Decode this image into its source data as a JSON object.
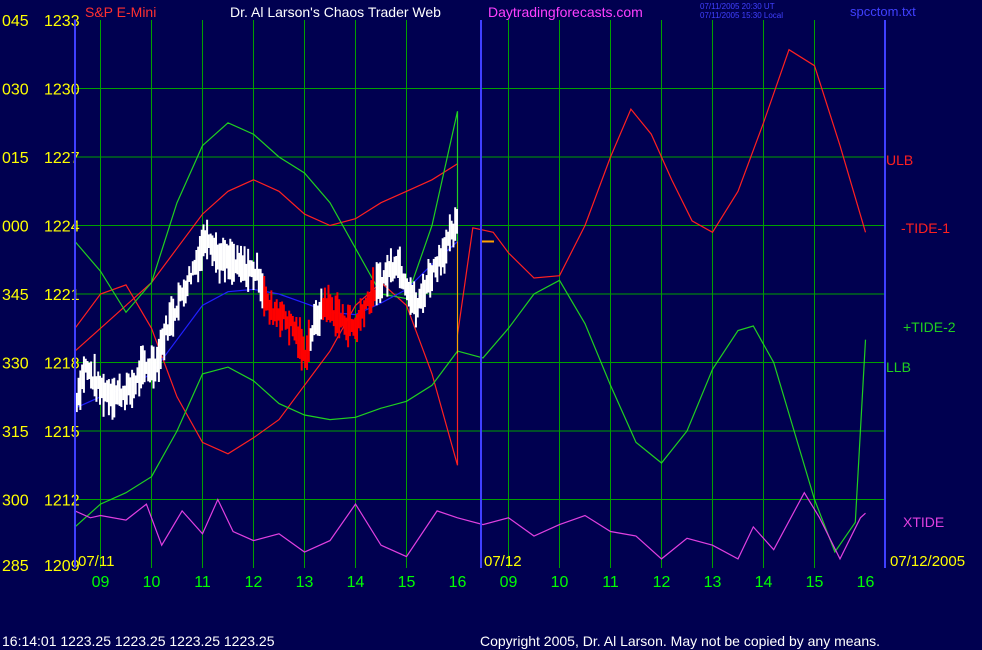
{
  "header": {
    "instrument": "S&P E-Mini",
    "title": "Dr. Al Larson's Chaos Trader Web",
    "site": "Daytradingforecasts.com",
    "stamp_line1": "07/11/2005 20:30 UT",
    "stamp_line2": "07/11/2005 15:30 Local",
    "filename": "spcctom.txt"
  },
  "footer": {
    "status": "16:14:01  1223.25 1223.25 1223.25 1223.25",
    "copyright": "Copyright 2005, Dr. Al Larson. May not be copied by any means."
  },
  "labels": {
    "day1": "07/11",
    "day2": "07/12",
    "day_end": "07/12/2005"
  },
  "colors": {
    "background": "#000050",
    "grid": "#00a000",
    "axis": "#4040ff",
    "price_axis": "#ffff00",
    "hour_labels": "#00ff00",
    "ulb": "#ff2020",
    "tide1": "#ff2020",
    "tide2": "#20d020",
    "llb": "#20d020",
    "xtide": "#e040e0",
    "price_bars": "#ffffff",
    "price_down": "#ff0000",
    "moving_avg": "#2020ff",
    "header_title": "#ffffff",
    "header_site": "#ff40ff",
    "filename": "#4040ff"
  },
  "chart_data": {
    "type": "line",
    "title": "Dr. Al Larson's Chaos Trader Web",
    "y_axis": {
      "ticks": [
        {
          "code": "045",
          "price": "1233"
        },
        {
          "code": "030",
          "price": "1230"
        },
        {
          "code": "015",
          "price": "1227"
        },
        {
          "code": "000",
          "price": "1224"
        },
        {
          "code": "345",
          "price": "1221"
        },
        {
          "code": "330",
          "price": "1218"
        },
        {
          "code": "315",
          "price": "1215"
        },
        {
          "code": "300",
          "price": "1212"
        },
        {
          "code": "285",
          "price": "1209"
        }
      ],
      "ylim": [
        1209,
        1233
      ]
    },
    "x_axis": {
      "ticks": [
        "09",
        "10",
        "11",
        "12",
        "13",
        "14",
        "15",
        "16",
        "09",
        "10",
        "11",
        "12",
        "13",
        "14",
        "15",
        "16"
      ],
      "xlim": [
        8.5,
        24.0
      ]
    },
    "grid": true,
    "series": [
      {
        "name": "ULB",
        "points": [
          [
            8.5,
            1218.5
          ],
          [
            9,
            1219.5
          ],
          [
            9.5,
            1220.5
          ],
          [
            10,
            1221.5
          ],
          [
            10.5,
            1223
          ],
          [
            11,
            1224.5
          ],
          [
            11.5,
            1225.5
          ],
          [
            12,
            1226
          ],
          [
            12.5,
            1225.5
          ],
          [
            13,
            1224.5
          ],
          [
            13.5,
            1224
          ],
          [
            14,
            1224.3
          ],
          [
            14.5,
            1225
          ],
          [
            15,
            1225.5
          ],
          [
            15.5,
            1226
          ],
          [
            16,
            1226.7
          ]
        ]
      },
      {
        "name": "-TIDE-1",
        "points": [
          [
            8.5,
            1219.5
          ],
          [
            9,
            1221
          ],
          [
            9.5,
            1221.4
          ],
          [
            10,
            1219.5
          ],
          [
            10.5,
            1216.5
          ],
          [
            11,
            1214.5
          ],
          [
            11.5,
            1214
          ],
          [
            12,
            1214.7
          ],
          [
            12.5,
            1215.5
          ],
          [
            13,
            1217
          ],
          [
            13.5,
            1218.5
          ],
          [
            14,
            1220.5
          ],
          [
            14.5,
            1221.5
          ],
          [
            15,
            1220.5
          ],
          [
            15.5,
            1217.5
          ],
          [
            16,
            1213.5
          ],
          [
            16,
            1219.2
          ],
          [
            16.3,
            1223.9
          ],
          [
            16.7,
            1223.7
          ],
          [
            17,
            1222.8
          ],
          [
            17.5,
            1221.7
          ],
          [
            18,
            1221.8
          ],
          [
            18.5,
            1224
          ],
          [
            19,
            1227
          ],
          [
            19.4,
            1229.1
          ],
          [
            19.8,
            1228
          ],
          [
            20.2,
            1226
          ],
          [
            20.6,
            1224.2
          ],
          [
            21,
            1223.7
          ],
          [
            21.5,
            1225.5
          ],
          [
            22,
            1228.5
          ],
          [
            22.5,
            1231.7
          ],
          [
            23,
            1231
          ],
          [
            23.5,
            1227.5
          ],
          [
            24,
            1223.7
          ]
        ]
      },
      {
        "name": "+TIDE-2",
        "points": [
          [
            8.5,
            1223.3
          ],
          [
            9,
            1222
          ],
          [
            9.5,
            1220.2
          ],
          [
            10,
            1221.5
          ],
          [
            10.5,
            1225
          ],
          [
            11,
            1227.5
          ],
          [
            11.5,
            1228.5
          ],
          [
            12,
            1228
          ],
          [
            12.5,
            1227
          ],
          [
            13,
            1226.3
          ],
          [
            13.5,
            1225
          ],
          [
            14,
            1223
          ],
          [
            14.5,
            1221
          ],
          [
            15,
            1220.8
          ],
          [
            15.5,
            1224
          ],
          [
            16,
            1229
          ],
          [
            16,
            1218.5
          ],
          [
            16.5,
            1218.2
          ],
          [
            17,
            1219.5
          ],
          [
            17.5,
            1221
          ],
          [
            18,
            1221.6
          ],
          [
            18.5,
            1219.7
          ],
          [
            19,
            1217
          ],
          [
            19.5,
            1214.5
          ],
          [
            20,
            1213.6
          ],
          [
            20.5,
            1215
          ],
          [
            21,
            1217.7
          ],
          [
            21.5,
            1219.4
          ],
          [
            21.8,
            1219.6
          ],
          [
            22.2,
            1218
          ],
          [
            22.6,
            1215
          ],
          [
            23,
            1212
          ],
          [
            23.4,
            1209.7
          ],
          [
            23.8,
            1211
          ],
          [
            24,
            1219
          ]
        ]
      },
      {
        "name": "LLB",
        "points": [
          [
            8.5,
            1210.8
          ],
          [
            9,
            1211.8
          ],
          [
            9.5,
            1212.3
          ],
          [
            10,
            1213
          ],
          [
            10.5,
            1215
          ],
          [
            11,
            1217.5
          ],
          [
            11.5,
            1217.8
          ],
          [
            12,
            1217.2
          ],
          [
            12.5,
            1216.2
          ],
          [
            13,
            1215.7
          ],
          [
            13.5,
            1215.5
          ],
          [
            14,
            1215.6
          ],
          [
            14.5,
            1216
          ],
          [
            15,
            1216.3
          ],
          [
            15.5,
            1217
          ],
          [
            16,
            1218.5
          ]
        ]
      },
      {
        "name": "XTIDE",
        "points": [
          [
            8.5,
            1211.5
          ],
          [
            8.8,
            1211.2
          ],
          [
            9,
            1211.3
          ],
          [
            9.5,
            1211.1
          ],
          [
            9.9,
            1211.8
          ],
          [
            10.2,
            1210
          ],
          [
            10.6,
            1211.5
          ],
          [
            11,
            1210.5
          ],
          [
            11.3,
            1212
          ],
          [
            11.6,
            1210.6
          ],
          [
            12,
            1210.2
          ],
          [
            12.5,
            1210.5
          ],
          [
            13,
            1209.7
          ],
          [
            13.5,
            1210.2
          ],
          [
            14,
            1211.8
          ],
          [
            14.5,
            1210
          ],
          [
            15,
            1209.5
          ],
          [
            15.6,
            1211.5
          ],
          [
            16,
            1211.2
          ],
          [
            16.5,
            1210.9
          ],
          [
            17,
            1211.2
          ],
          [
            17.5,
            1210.4
          ],
          [
            18,
            1210.9
          ],
          [
            18.5,
            1211.3
          ],
          [
            19,
            1210.6
          ],
          [
            19.5,
            1210.4
          ],
          [
            20,
            1209.4
          ],
          [
            20.5,
            1210.3
          ],
          [
            21,
            1210
          ],
          [
            21.5,
            1209.4
          ],
          [
            21.8,
            1210.8
          ],
          [
            22.2,
            1209.8
          ],
          [
            22.8,
            1212.3
          ],
          [
            23.1,
            1211.2
          ],
          [
            23.5,
            1209.4
          ],
          [
            23.9,
            1211.2
          ],
          [
            24,
            1211.4
          ]
        ]
      },
      {
        "name": "Moving Average",
        "points": [
          [
            8.5,
            1216
          ],
          [
            9,
            1216.5
          ],
          [
            9.5,
            1216.9
          ],
          [
            10,
            1217.5
          ],
          [
            10.5,
            1219
          ],
          [
            11,
            1220.5
          ],
          [
            11.5,
            1221.1
          ],
          [
            12,
            1221.2
          ],
          [
            12.5,
            1221
          ],
          [
            13,
            1220.6
          ],
          [
            13.5,
            1220.2
          ],
          [
            14,
            1220.1
          ],
          [
            14.5,
            1220.6
          ],
          [
            15,
            1221.2
          ],
          [
            15.5,
            1222.3
          ],
          [
            16,
            1223.3
          ]
        ]
      }
    ],
    "price_path": [
      [
        8.5,
        1216.2
      ],
      [
        8.7,
        1217.8
      ],
      [
        9,
        1216.8
      ],
      [
        9.3,
        1216.6
      ],
      [
        9.6,
        1216.8
      ],
      [
        9.8,
        1217.6
      ],
      [
        10.1,
        1218
      ],
      [
        10.3,
        1219.5
      ],
      [
        10.6,
        1221
      ],
      [
        10.9,
        1222.5
      ],
      [
        11.1,
        1223.7
      ],
      [
        11.3,
        1222.6
      ],
      [
        11.7,
        1222.2
      ],
      [
        12.1,
        1221.9
      ],
      [
        12.3,
        1220.3
      ],
      [
        12.5,
        1220.2
      ],
      [
        12.8,
        1219.5
      ],
      [
        13,
        1218.3
      ],
      [
        13.2,
        1219.7
      ],
      [
        13.4,
        1220.6
      ],
      [
        13.7,
        1219.9
      ],
      [
        14,
        1219.5
      ],
      [
        14.2,
        1220.6
      ],
      [
        14.5,
        1221.5
      ],
      [
        14.8,
        1222.5
      ],
      [
        15,
        1221.5
      ],
      [
        15.2,
        1220.3
      ],
      [
        15.4,
        1221.5
      ],
      [
        15.7,
        1222.8
      ],
      [
        16,
        1224
      ]
    ],
    "red_segments": [
      [
        12.2,
        13.1
      ],
      [
        13.35,
        14.4
      ]
    ],
    "forecast_mark": 1223.3
  }
}
